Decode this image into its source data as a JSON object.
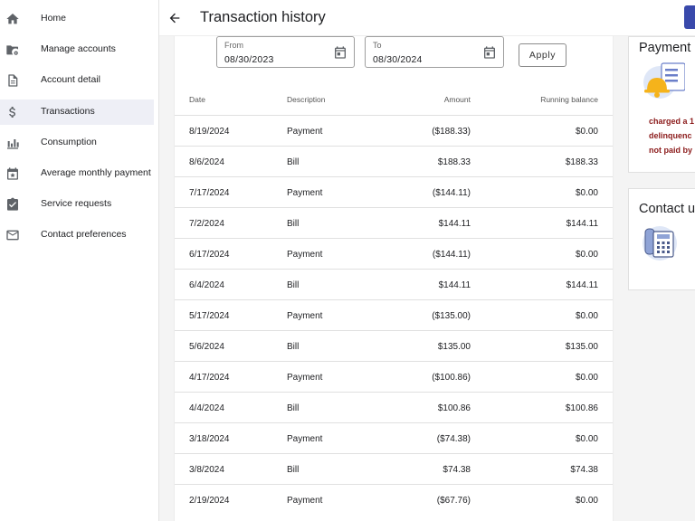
{
  "sidebar": {
    "items": [
      {
        "label": "Home",
        "icon": "home-icon"
      },
      {
        "label": "Manage accounts",
        "icon": "folder-gear-icon"
      },
      {
        "label": "Account detail",
        "icon": "document-icon"
      },
      {
        "label": "Transactions",
        "icon": "dollar-icon",
        "active": true
      },
      {
        "label": "Consumption",
        "icon": "bar-chart-icon"
      },
      {
        "label": "Average monthly payment",
        "icon": "calendar-star-icon"
      },
      {
        "label": "Service requests",
        "icon": "clipboard-check-icon"
      },
      {
        "label": "Contact preferences",
        "icon": "envelope-icon"
      }
    ]
  },
  "header": {
    "title": "Transaction history"
  },
  "filter": {
    "from_label": "From",
    "from_value": "08/30/2023",
    "to_label": "To",
    "to_value": "08/30/2024",
    "apply_label": "Apply"
  },
  "table": {
    "columns": [
      "Date",
      "Description",
      "Amount",
      "Running balance"
    ],
    "rows": [
      {
        "date": "8/19/2024",
        "desc": "Payment",
        "amount": "($188.33)",
        "balance": "$0.00"
      },
      {
        "date": "8/6/2024",
        "desc": "Bill",
        "amount": "$188.33",
        "balance": "$188.33"
      },
      {
        "date": "7/17/2024",
        "desc": "Payment",
        "amount": "($144.11)",
        "balance": "$0.00"
      },
      {
        "date": "7/2/2024",
        "desc": "Bill",
        "amount": "$144.11",
        "balance": "$144.11"
      },
      {
        "date": "6/17/2024",
        "desc": "Payment",
        "amount": "($144.11)",
        "balance": "$0.00"
      },
      {
        "date": "6/4/2024",
        "desc": "Bill",
        "amount": "$144.11",
        "balance": "$144.11"
      },
      {
        "date": "5/17/2024",
        "desc": "Payment",
        "amount": "($135.00)",
        "balance": "$0.00"
      },
      {
        "date": "5/6/2024",
        "desc": "Bill",
        "amount": "$135.00",
        "balance": "$135.00"
      },
      {
        "date": "4/17/2024",
        "desc": "Payment",
        "amount": "($100.86)",
        "balance": "$0.00"
      },
      {
        "date": "4/4/2024",
        "desc": "Bill",
        "amount": "$100.86",
        "balance": "$100.86"
      },
      {
        "date": "3/18/2024",
        "desc": "Payment",
        "amount": "($74.38)",
        "balance": "$0.00"
      },
      {
        "date": "3/8/2024",
        "desc": "Bill",
        "amount": "$74.38",
        "balance": "$74.38"
      },
      {
        "date": "2/19/2024",
        "desc": "Payment",
        "amount": "($67.76)",
        "balance": "$0.00"
      }
    ]
  },
  "payment_card": {
    "title": "Payment",
    "lines": [
      "charged a 1",
      "delinquenc",
      "not paid by"
    ],
    "warn_color": "#8b1a1a",
    "icon": "bell-document-icon"
  },
  "contact_card": {
    "title": "Contact u",
    "icon": "telephone-icon"
  },
  "colors": {
    "accent": "#3949ab",
    "active_nav_bg": "#eeeff6"
  }
}
